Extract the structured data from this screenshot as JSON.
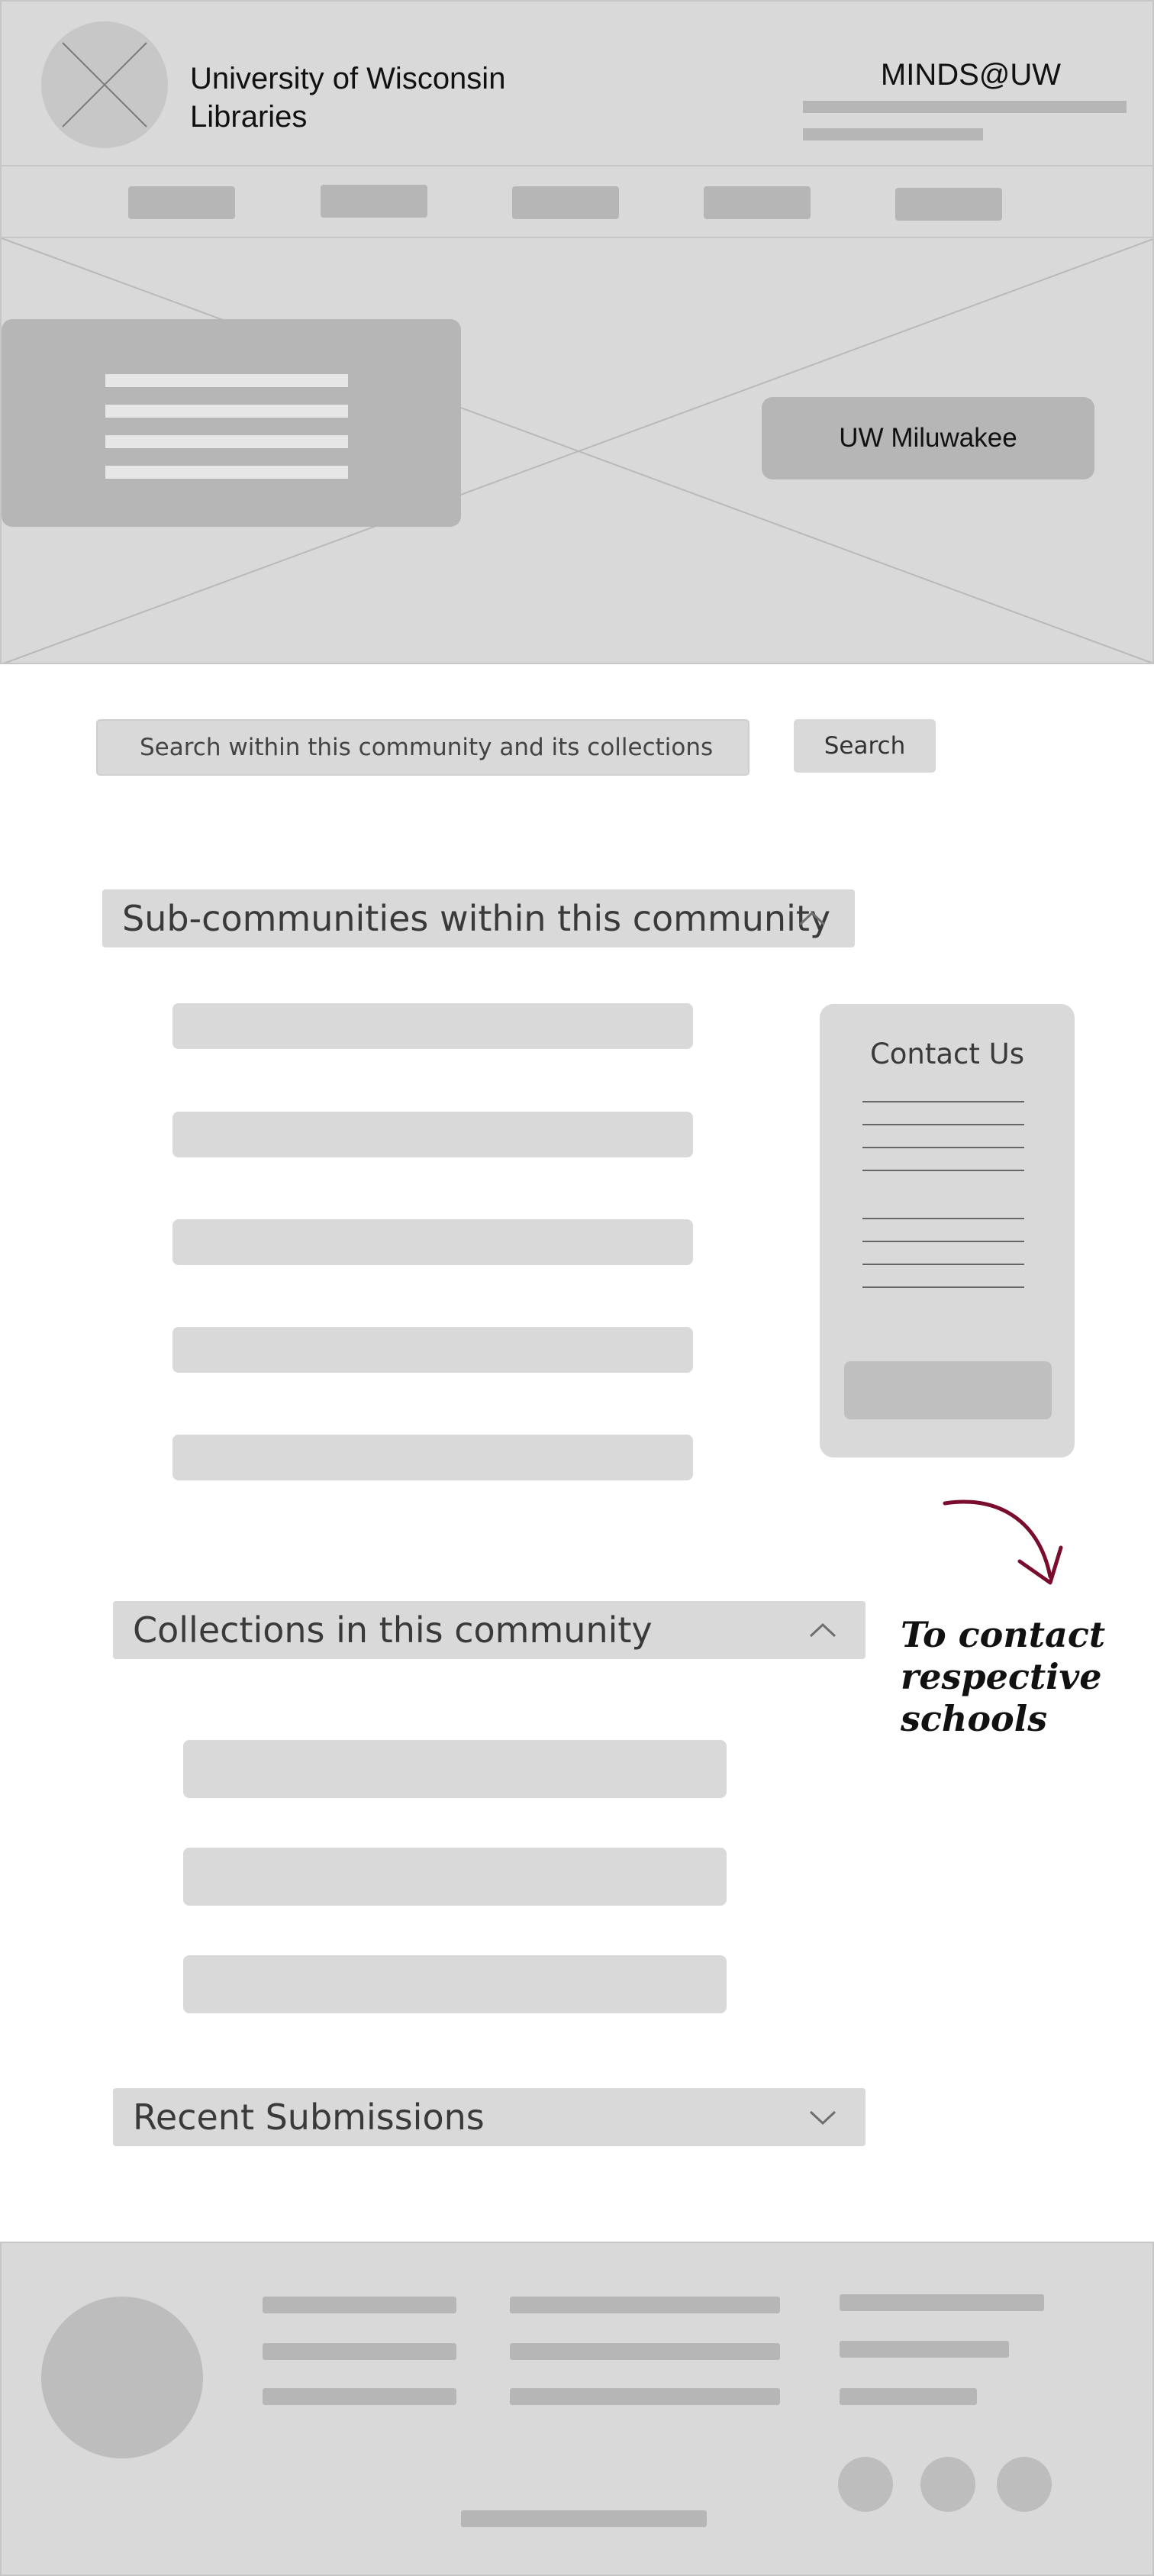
{
  "header": {
    "site_title_line1": "University of Wisconsin",
    "site_title_line2": "Libraries",
    "brand": "MINDS@UW",
    "logo_icon": "placeholder-image-icon"
  },
  "hero": {
    "campus_button": "UW Miluwakee"
  },
  "search": {
    "placeholder": "Search within this community and its collections",
    "button_label": "Search"
  },
  "sections": {
    "subcommunities": {
      "title": "Sub-communities within this community",
      "icon": "chevron-up-icon",
      "expanded": true
    },
    "collections": {
      "title": "Collections in this community",
      "icon": "chevron-up-icon",
      "expanded": true
    },
    "recent": {
      "title": "Recent Submissions",
      "icon": "chevron-down-icon",
      "expanded": false
    }
  },
  "contact": {
    "title": "Contact Us"
  },
  "annotation": {
    "line1": "To contact",
    "line2": "respective",
    "line3": "schools",
    "color": "#7a0c2e"
  },
  "colors": {
    "wireframe_gray": "#d9d9d9",
    "block_gray": "#b6b6b6",
    "accent": "#7a0c2e"
  }
}
